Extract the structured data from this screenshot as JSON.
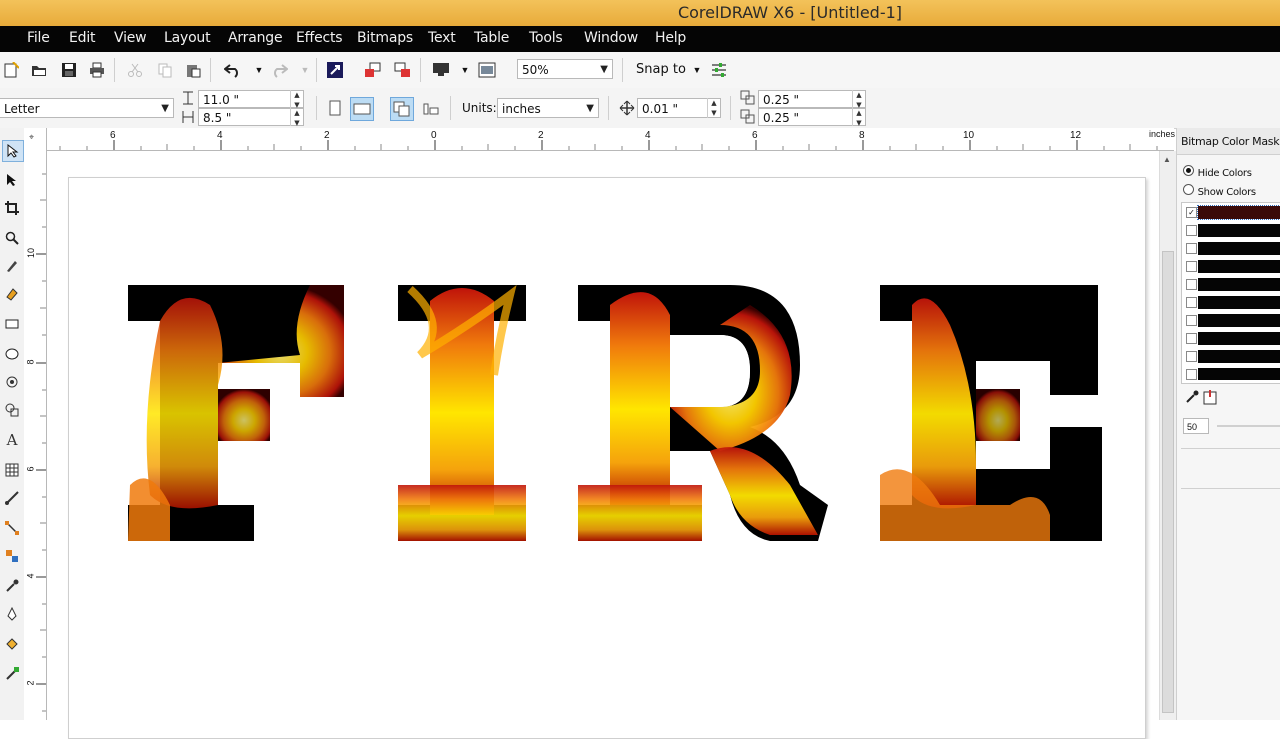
{
  "window": {
    "title": "CorelDRAW X6 - [Untitled-1]"
  },
  "menu": [
    "File",
    "Edit",
    "View",
    "Layout",
    "Arrange",
    "Effects",
    "Bitmaps",
    "Text",
    "Table",
    "Tools",
    "Window",
    "Help"
  ],
  "toolbar": {
    "zoom": "50%",
    "snap_to": "Snap to"
  },
  "property_bar": {
    "page_size": "Letter",
    "width": "11.0 \"",
    "height": "8.5 \"",
    "units_label": "Units:",
    "units": "inches",
    "nudge": "0.01 \"",
    "dup_x": "0.25 \"",
    "dup_y": "0.25 \""
  },
  "ruler": {
    "h_ticks": [
      "6",
      "4",
      "2",
      "0",
      "2",
      "4",
      "6",
      "8",
      "10",
      "12"
    ],
    "unit": "inches",
    "v_ticks": [
      "10",
      "8",
      "6",
      "4",
      "2"
    ]
  },
  "artwork": {
    "text": "FIRE",
    "letters": [
      "F",
      "I",
      "R",
      "E"
    ],
    "colors": {
      "flame_dark": "#c0140a",
      "flame_mid": "#f07a0c",
      "flame_light": "#ffe600",
      "background": "#000000"
    }
  },
  "docker": {
    "title": "Bitmap Color Mask",
    "hide_colors": "Hide Colors",
    "show_colors": "Show Colors",
    "selected_mode": "hide",
    "tolerance": "50",
    "color_rows": [
      {
        "checked": true,
        "color": "#3a0a08"
      },
      {
        "checked": false,
        "color": "#050505"
      },
      {
        "checked": false,
        "color": "#050505"
      },
      {
        "checked": false,
        "color": "#050505"
      },
      {
        "checked": false,
        "color": "#050505"
      },
      {
        "checked": false,
        "color": "#050505"
      },
      {
        "checked": false,
        "color": "#050505"
      },
      {
        "checked": false,
        "color": "#050505"
      },
      {
        "checked": false,
        "color": "#050505"
      },
      {
        "checked": false,
        "color": "#050505"
      }
    ]
  }
}
